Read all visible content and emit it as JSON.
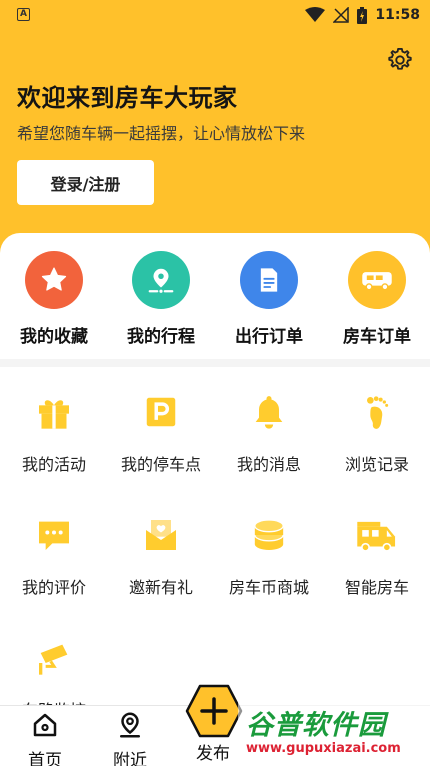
{
  "status_bar": {
    "time": "11:58",
    "app_icon": "A"
  },
  "header": {
    "welcome": "欢迎来到房车大玩家",
    "subtitle": "希望您随车辆一起摇摆，让心情放松下来",
    "login_button": "登录/注册",
    "settings_icon": "gear-icon",
    "background_color": "#ffc12b"
  },
  "quick_actions": [
    {
      "label": "我的收藏",
      "icon": "star-icon",
      "color": "#f2633c"
    },
    {
      "label": "我的行程",
      "icon": "location-route-icon",
      "color": "#2bc2a6"
    },
    {
      "label": "出行订单",
      "icon": "document-icon",
      "color": "#3f86ea"
    },
    {
      "label": "房车订单",
      "icon": "rv-icon",
      "color": "#ffc12b"
    }
  ],
  "menu_items": [
    {
      "label": "我的活动",
      "icon": "gift-icon"
    },
    {
      "label": "我的停车点",
      "icon": "parking-icon"
    },
    {
      "label": "我的消息",
      "icon": "bell-icon"
    },
    {
      "label": "浏览记录",
      "icon": "footprint-icon"
    },
    {
      "label": "我的评价",
      "icon": "chat-bubble-icon"
    },
    {
      "label": "邀新有礼",
      "icon": "envelope-heart-icon"
    },
    {
      "label": "房车币商城",
      "icon": "coin-stack-icon"
    },
    {
      "label": "智能房车",
      "icon": "camper-icon"
    },
    {
      "label": "车路监控",
      "icon": "cctv-camera-icon"
    }
  ],
  "tab_bar": {
    "items": [
      {
        "label": "首页",
        "icon": "home-icon"
      },
      {
        "label": "附近",
        "icon": "location-pin-icon"
      },
      {
        "label": "发布",
        "icon": "plus-hexagon-icon"
      }
    ],
    "accent": "#ffc12b"
  },
  "watermark": {
    "title": "谷普软件园",
    "url": "www.gupuxiazai.com"
  }
}
